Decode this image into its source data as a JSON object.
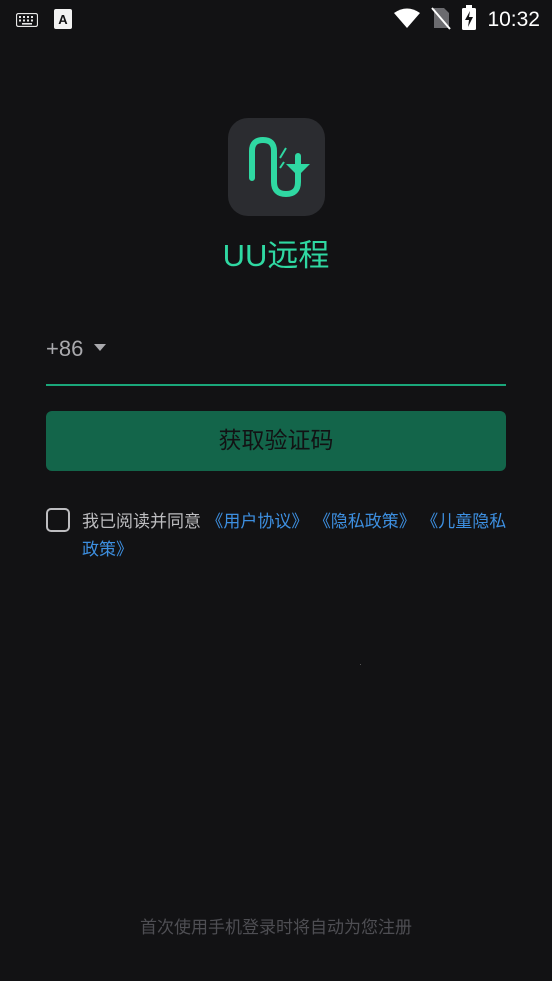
{
  "status_bar": {
    "time": "10:32",
    "icons": [
      "keyboard-icon",
      "text-a-icon",
      "wifi-icon",
      "no-sim-icon",
      "battery-charging-icon"
    ]
  },
  "app": {
    "name": "UU远程",
    "logo_icon": "uu-logo-icon",
    "accent_color": "#2fd8a2"
  },
  "login": {
    "country_code": "+86",
    "phone_placeholder": "",
    "get_code_button": "获取验证码"
  },
  "agreement": {
    "prefix": "我已阅读并同意",
    "user_agreement": "《用户协议》",
    "privacy_policy": "《隐私政策》",
    "children_privacy": "《儿童隐私政策》",
    "checked": false
  },
  "footer": {
    "note": "首次使用手机登录时将自动为您注册"
  }
}
